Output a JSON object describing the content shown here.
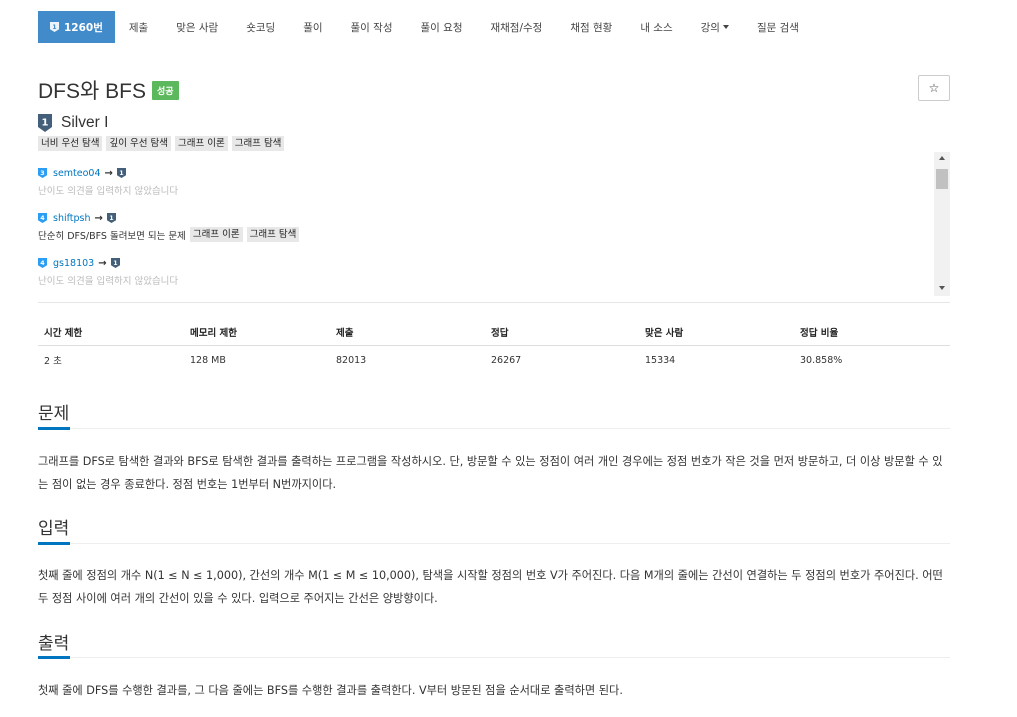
{
  "nav": {
    "problem_id": "1260번",
    "items": [
      "제출",
      "맞은 사람",
      "숏코딩",
      "풀이",
      "풀이 작성",
      "풀이 요청",
      "재채점/수정",
      "채점 현황",
      "내 소스",
      "강의",
      "질문 검색"
    ]
  },
  "problem": {
    "title": "DFS와 BFS",
    "status": "성공",
    "star": "☆",
    "tier": "Silver I",
    "tier_digit": "1",
    "tags": [
      "너비 우선 탐색",
      "깊이 우선 탐색",
      "그래프 이론",
      "그래프 탐색"
    ]
  },
  "opinions": [
    {
      "level": "3",
      "user": "semteo04",
      "arrow": "→",
      "to_level": "1",
      "text": "난이도 의견을 입력하지 않았습니다",
      "tags": []
    },
    {
      "level": "4",
      "user": "shiftpsh",
      "arrow": "→",
      "to_level": "1",
      "text": "단순히 DFS/BFS 돌려보면 되는 문제",
      "tags": [
        "그래프 이론",
        "그래프 탐색"
      ]
    },
    {
      "level": "4",
      "user": "gs18103",
      "arrow": "→",
      "to_level": "1",
      "text": "난이도 의견을 입력하지 않았습니다",
      "tags": []
    }
  ],
  "stats": {
    "headers": [
      "시간 제한",
      "메모리 제한",
      "제출",
      "정답",
      "맞은 사람",
      "정답 비율"
    ],
    "values": [
      "2 초",
      "128 MB",
      "82013",
      "26267",
      "15334",
      "30.858%"
    ]
  },
  "sections": {
    "problem_title": "문제",
    "problem_body": "그래프를 DFS로 탐색한 결과와 BFS로 탐색한 결과를 출력하는 프로그램을 작성하시오. 단, 방문할 수 있는 정점이 여러 개인 경우에는 정점 번호가 작은 것을 먼저 방문하고, 더 이상 방문할 수 있는 점이 없는 경우 종료한다. 정점 번호는 1번부터 N번까지이다.",
    "input_title": "입력",
    "input_body": "첫째 줄에 정점의 개수 N(1 ≤ N ≤ 1,000), 간선의 개수 M(1 ≤ M ≤ 10,000), 탐색을 시작할 정점의 번호 V가 주어진다. 다음 M개의 줄에는 간선이 연결하는 두 정점의 번호가 주어진다. 어떤 두 정점 사이에 여러 개의 간선이 있을 수 있다. 입력으로 주어지는 간선은 양방향이다.",
    "output_title": "출력",
    "output_body": "첫째 줄에 DFS를 수행한 결과를, 그 다음 줄에는 BFS를 수행한 결과를 출력한다. V부터 방문된 점을 순서대로 출력하면 된다."
  },
  "colors": {
    "nav_active": "#428bca",
    "success": "#5cb85c",
    "link": "#0076c0",
    "silver": "#435f7a",
    "bronze_like": "#2a9df4"
  }
}
